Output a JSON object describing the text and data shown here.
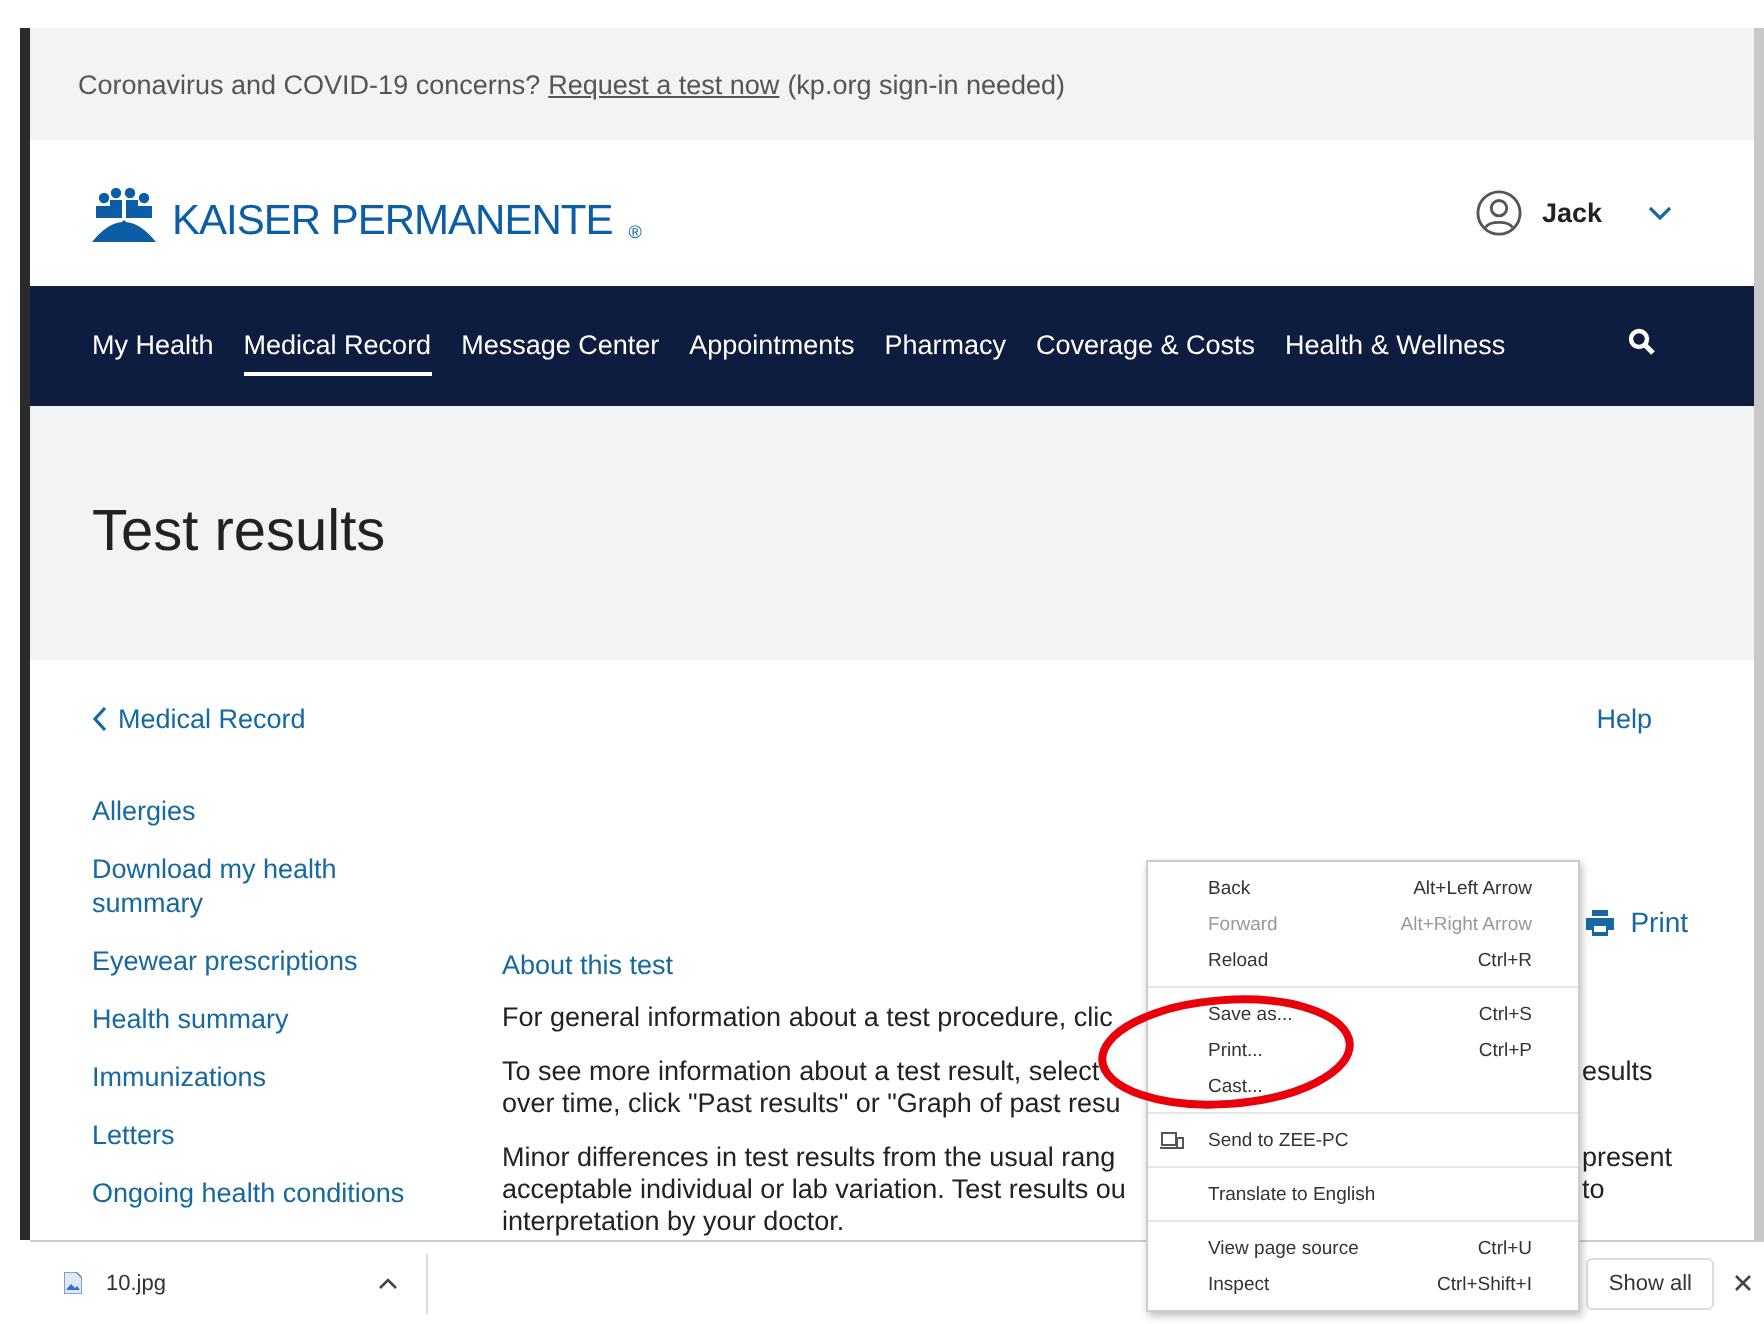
{
  "banner": {
    "text": "Coronavirus and COVID-19 concerns?",
    "link": "Request a test now",
    "note": "(kp.org sign-in needed)"
  },
  "header": {
    "logo": "KAISER PERMANENTE",
    "logo_mark": "®",
    "user": "Jack"
  },
  "nav": [
    {
      "label": "My Health",
      "selected": false
    },
    {
      "label": "Medical Record",
      "selected": true
    },
    {
      "label": "Message Center",
      "selected": false
    },
    {
      "label": "Appointments",
      "selected": false
    },
    {
      "label": "Pharmacy",
      "selected": false
    },
    {
      "label": "Coverage & Costs",
      "selected": false
    },
    {
      "label": "Health & Wellness",
      "selected": false
    }
  ],
  "page_title": "Test results",
  "breadcrumb": "Medical Record",
  "help": "Help",
  "sidebar": [
    "Allergies",
    "Download my health summary",
    "Eyewear prescriptions",
    "Health summary",
    "Immunizations",
    "Letters",
    "Ongoing health conditions"
  ],
  "print": "Print",
  "section_title": "About this test",
  "paragraphs": [
    {
      "lines": [
        {
          "left": "For general information about a test procedure, clic"
        }
      ]
    },
    {
      "lines": [
        {
          "left": "To see more information about a test result, select",
          "right": "esults"
        },
        {
          "left": "over time, click \"Past results\" or \"Graph of past resu"
        }
      ]
    },
    {
      "lines": [
        {
          "left": "Minor differences in test results from the usual rang",
          "right": "present"
        },
        {
          "left": "acceptable individual or lab variation. Test results ou",
          "right": "to"
        },
        {
          "left": "interpretation by your doctor."
        }
      ]
    }
  ],
  "context_menu": {
    "items": [
      {
        "kind": "item",
        "label": "Back",
        "shortcut": "Alt+Left Arrow",
        "disabled": false
      },
      {
        "kind": "item",
        "label": "Forward",
        "shortcut": "Alt+Right Arrow",
        "disabled": true
      },
      {
        "kind": "item",
        "label": "Reload",
        "shortcut": "Ctrl+R",
        "disabled": false
      },
      {
        "kind": "separator"
      },
      {
        "kind": "item",
        "label": "Save as...",
        "shortcut": "Ctrl+S",
        "disabled": false
      },
      {
        "kind": "item",
        "label": "Print...",
        "shortcut": "Ctrl+P",
        "disabled": false
      },
      {
        "kind": "item",
        "label": "Cast...",
        "disabled": false
      },
      {
        "kind": "separator"
      },
      {
        "kind": "device",
        "label": "Send to ZEE-PC",
        "disabled": false
      },
      {
        "kind": "separator"
      },
      {
        "kind": "item",
        "label": "Translate to English",
        "disabled": false
      },
      {
        "kind": "separator"
      },
      {
        "kind": "item",
        "label": "View page source",
        "shortcut": "Ctrl+U",
        "disabled": false
      },
      {
        "kind": "item",
        "label": "Inspect",
        "shortcut": "Ctrl+Shift+I",
        "disabled": false
      }
    ]
  },
  "download_bar": {
    "file": "10.jpg",
    "show_all": "Show all"
  }
}
